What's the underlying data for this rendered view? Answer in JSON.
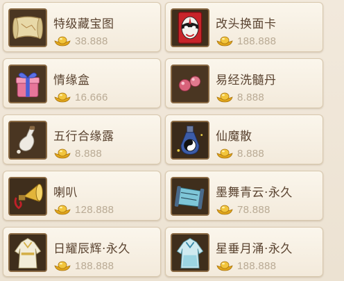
{
  "shop": {
    "currency_icon": "gold-ingot-icon",
    "items": [
      {
        "name": "特级藏宝图",
        "price": "38.888",
        "icon": "treasure-map-icon"
      },
      {
        "name": "改头换面卡",
        "price": "188.888",
        "icon": "opera-mask-card-icon"
      },
      {
        "name": "情缘盒",
        "price": "16.666",
        "icon": "gift-box-icon"
      },
      {
        "name": "易经洗髓丹",
        "price": "8.888",
        "icon": "pills-icon"
      },
      {
        "name": "五行合缘露",
        "price": "8.888",
        "icon": "gourd-bottle-icon"
      },
      {
        "name": "仙魔散",
        "price": "8.888",
        "icon": "taiji-potion-icon"
      },
      {
        "name": "喇叭",
        "price": "128.888",
        "icon": "gramophone-horn-icon"
      },
      {
        "name": "墨舞青云·永久",
        "price": "78.888",
        "icon": "scroll-mount-icon"
      },
      {
        "name": "日耀辰辉·永久",
        "price": "188.888",
        "icon": "robe-outfit-icon"
      },
      {
        "name": "星垂月涌·永久",
        "price": "188.888",
        "icon": "blue-robe-outfit-icon"
      }
    ]
  },
  "colors": {
    "card_bg": "#f7f0e3",
    "name_text": "#5a4330",
    "price_text": "#b9aa94",
    "gold": "#e0a51a"
  }
}
